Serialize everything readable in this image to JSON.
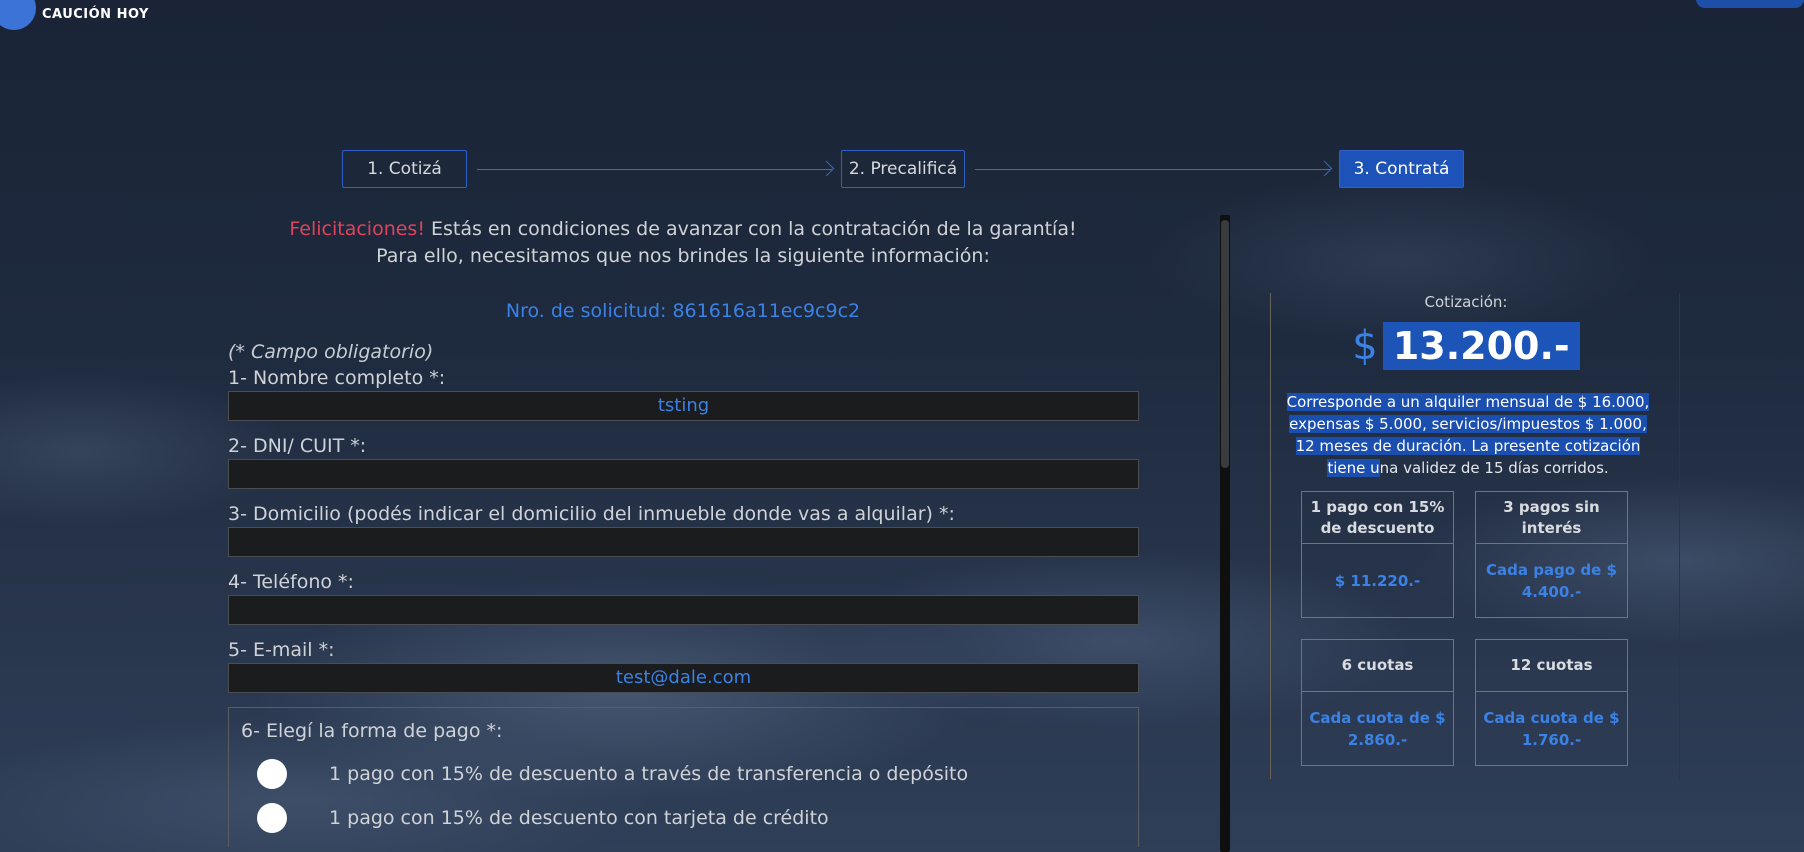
{
  "brand": {
    "name": "CAUCIÓN HOY"
  },
  "steps": [
    {
      "label": "1. Cotizá"
    },
    {
      "label": "2. Precalificá"
    },
    {
      "label": "3. Contratá"
    }
  ],
  "intro": {
    "highlight": "Felicitaciones!",
    "line1": " Estás en condiciones de avanzar con la contratación de la garantía!",
    "line2": "Para ello, necesitamos que nos brindes la siguiente información:"
  },
  "request": {
    "text": "Nro. de solicitud: 861616a11ec9c9c2"
  },
  "form": {
    "required_note": "(* Campo obligatorio)",
    "fields": [
      {
        "label": "1- Nombre completo *:",
        "value": "tsting"
      },
      {
        "label": "2- DNI/ CUIT *:",
        "value": ""
      },
      {
        "label": "3- Domicilio (podés indicar el domicilio del inmueble donde vas a alquilar) *:",
        "value": ""
      },
      {
        "label": "4- Teléfono *:",
        "value": ""
      },
      {
        "label": "5- E-mail *:",
        "value": "test@dale.com"
      }
    ],
    "payment": {
      "label": "6- Elegí la forma de pago *:",
      "options": [
        "1 pago con 15% de descuento a través de transferencia o depósito",
        "1 pago con 15% de descuento con tarjeta de crédito"
      ]
    }
  },
  "quote": {
    "label": "Cotización:",
    "currency": "$",
    "amount": "13.200.-",
    "description_selected": "Corresponde a un alquiler mensual de $ 16.000, expensas $ 5.000, servicios/impuestos $ 1.000, 12 meses de duración. La presente cotización tiene u",
    "description_rest": "na validez de 15 días corridos.",
    "options": [
      {
        "title": "1 pago con 15% de descuento",
        "value": "$ 11.220.-"
      },
      {
        "title": "3 pagos sin interés",
        "value": "Cada pago de $ 4.400.-"
      },
      {
        "title": "6 cuotas",
        "value": "Cada cuota de $ 2.860.-"
      },
      {
        "title": "12 cuotas",
        "value": "Cada cuota de $ 1.760.-"
      }
    ]
  },
  "colors": {
    "accent": "#3b82e6",
    "highlight_red": "#e0445a",
    "selection_blue": "#1c54b8"
  }
}
